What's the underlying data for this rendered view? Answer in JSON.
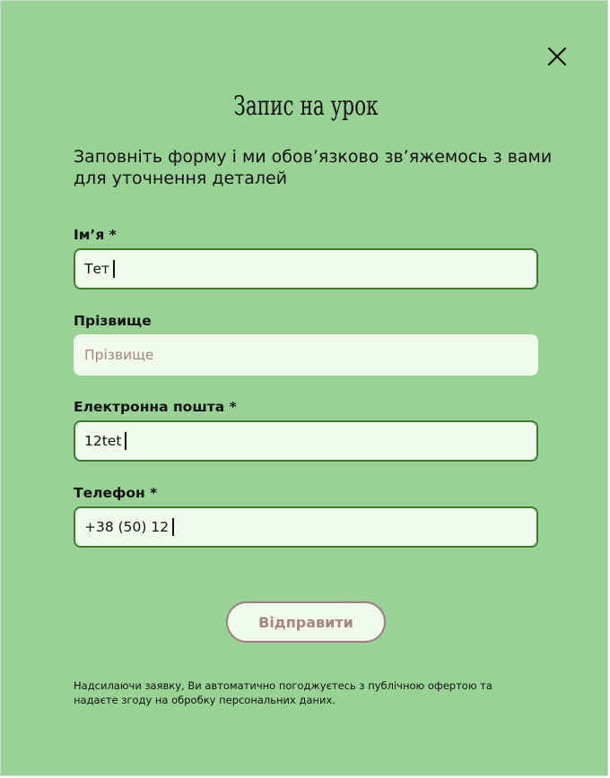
{
  "form": {
    "title": "Запис на урок",
    "subtitle": "Заповніть форму і ми обов’язково зв’яжемось з вами для уточнення деталей",
    "first_name": {
      "label": "Ім’я *",
      "value": "Тет"
    },
    "last_name": {
      "label": "Прізвище",
      "placeholder": "Прізвище"
    },
    "email": {
      "label": "Електронна пошта *",
      "value": "12tet"
    },
    "phone": {
      "label": "Телефон *",
      "value": "+38 (50) 12"
    },
    "submit_label": "Відправити",
    "disclaimer": "Надсилаючи заявку, Ви автоматично погоджуєтесь з публічною офертою та надаєте згоду на обробку персональних даних."
  },
  "icons": {
    "close": "close-icon"
  },
  "colors": {
    "background": "#99d295",
    "field_background": "#f0fbee",
    "field_border": "#3c7a2c",
    "button_text": "#a88484",
    "button_border": "#a07f82"
  }
}
